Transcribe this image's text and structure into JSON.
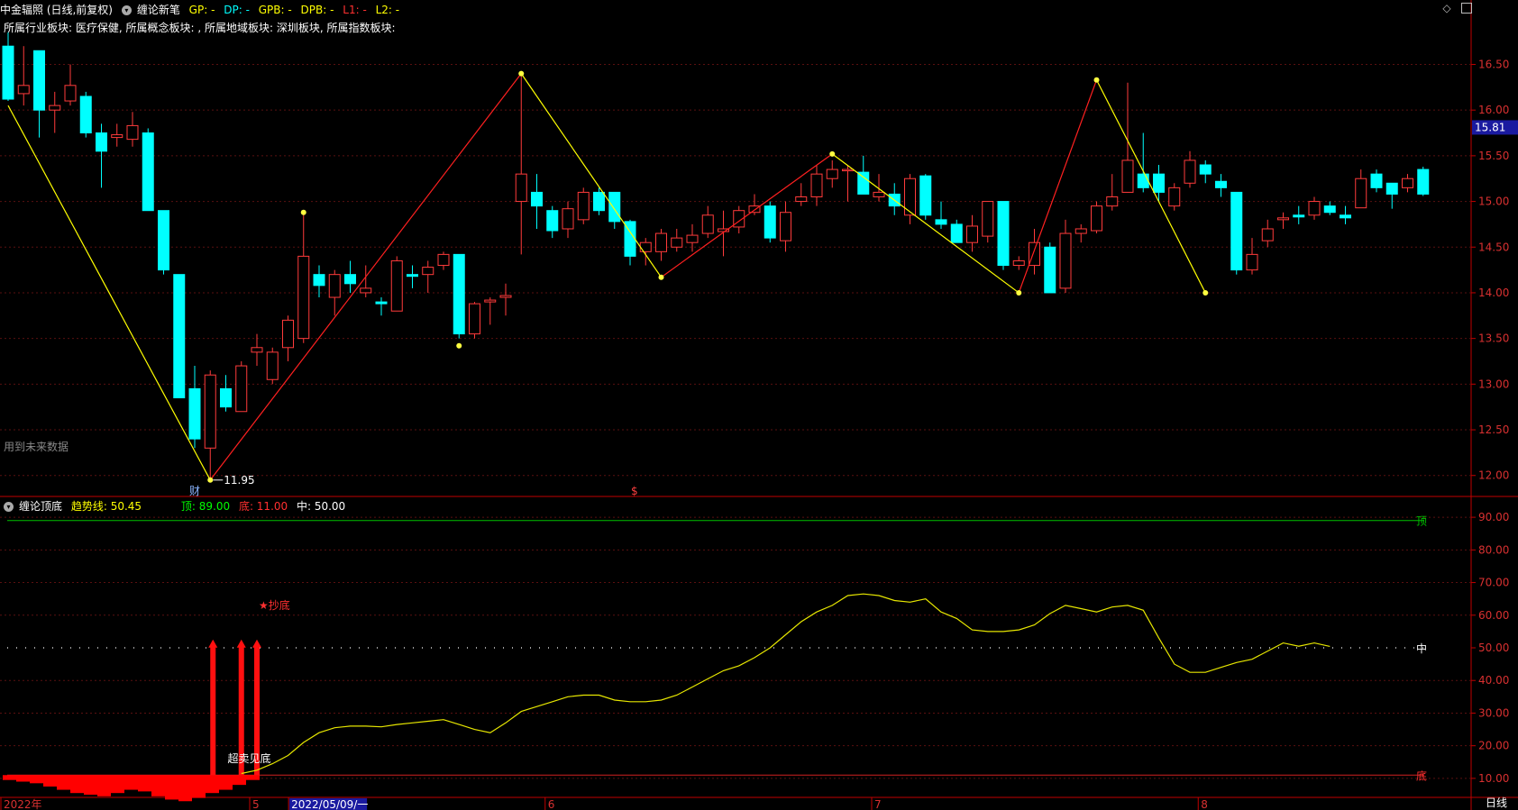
{
  "header": {
    "stock_title": "中金辐照 (日线,前复权)",
    "indicator_name": "缠论新笔",
    "gp_label": "GP: -",
    "dp_label": "DP: -",
    "gpb_label": "GPB: -",
    "dpb_label": "DPB: -",
    "l1_label": "L1: -",
    "l2_label": "L2: -",
    "industry_line": "所属行业板块: 医疗保健, 所属概念板块: , 所属地域板块: 深圳板块, 所属指数板块:",
    "overlay_text": "所属行业板块:",
    "future_data_note": "用到未来数据",
    "period_label": "日线"
  },
  "sub_header": {
    "indicator_name": "缠论顶底",
    "trend_label": "趋势线: 50.45",
    "top_label": "顶: 89.00",
    "bottom_label": "底: 11.00",
    "mid_label": "中: 50.00"
  },
  "colors": {
    "up": "#ff3b3b",
    "down": "#00ffff",
    "stroke_yellow": "#ffff00",
    "stroke_red": "#ff2020",
    "grid": "#5a1010",
    "axis": "#c00000",
    "green_line": "#00c000",
    "trend_line": "#e6e600",
    "bottom_line": "#d02020",
    "price_badge_bg": "#1a1aa0"
  },
  "chart_data": [
    {
      "type": "candlestick",
      "title": "",
      "ylim": [
        11.8,
        16.85
      ],
      "y_ticks": [
        "16.50",
        "16.00",
        "15.50",
        "15.00",
        "14.50",
        "14.00",
        "13.50",
        "13.00",
        "12.50",
        "12.00"
      ],
      "y_tick_values": [
        16.5,
        16.0,
        15.5,
        15.0,
        14.5,
        14.0,
        13.5,
        13.0,
        12.5,
        12.0
      ],
      "current_price": "15.81",
      "current_price_value": 15.81,
      "low_annotation": "11.95",
      "event_markers": [
        "财",
        "$"
      ],
      "candles": [
        [
          16.7,
          16.12,
          16.85,
          16.1
        ],
        [
          16.18,
          16.27,
          16.7,
          16.05
        ],
        [
          16.65,
          16.0,
          16.65,
          15.7
        ],
        [
          16.0,
          16.05,
          16.2,
          15.75
        ],
        [
          16.1,
          16.27,
          16.5,
          16.05
        ],
        [
          16.15,
          15.75,
          16.2,
          15.7
        ],
        [
          15.75,
          15.55,
          15.85,
          15.15
        ],
        [
          15.7,
          15.73,
          15.85,
          15.6
        ],
        [
          15.68,
          15.83,
          15.98,
          15.6
        ],
        [
          15.75,
          14.9,
          15.8,
          14.9
        ],
        [
          14.9,
          14.25,
          14.9,
          14.2
        ],
        [
          14.2,
          12.85,
          14.2,
          12.85
        ],
        [
          12.95,
          12.4,
          13.2,
          12.3
        ],
        [
          12.3,
          13.1,
          13.15,
          11.95
        ],
        [
          12.95,
          12.75,
          13.1,
          12.7
        ],
        [
          12.7,
          13.2,
          13.25,
          12.7
        ],
        [
          13.35,
          13.4,
          13.55,
          13.2
        ],
        [
          13.05,
          13.35,
          13.4,
          13.0
        ],
        [
          13.4,
          13.7,
          13.75,
          13.25
        ],
        [
          13.5,
          14.4,
          14.88,
          13.45
        ],
        [
          14.2,
          14.08,
          14.3,
          13.95
        ],
        [
          13.95,
          14.2,
          14.25,
          13.75
        ],
        [
          14.2,
          14.1,
          14.35,
          14.0
        ],
        [
          14.0,
          14.05,
          14.3,
          13.95
        ],
        [
          13.9,
          13.88,
          13.95,
          13.75
        ],
        [
          13.8,
          14.35,
          14.4,
          13.8
        ],
        [
          14.2,
          14.18,
          14.3,
          14.05
        ],
        [
          14.2,
          14.28,
          14.35,
          14.0
        ],
        [
          14.3,
          14.42,
          14.45,
          14.25
        ],
        [
          14.42,
          13.55,
          14.42,
          13.5
        ],
        [
          13.55,
          13.88,
          13.9,
          13.5
        ],
        [
          13.9,
          13.92,
          13.95,
          13.65
        ],
        [
          13.95,
          13.97,
          14.1,
          13.75
        ],
        [
          15.0,
          15.3,
          16.4,
          14.42
        ],
        [
          15.1,
          14.95,
          15.3,
          14.7
        ],
        [
          14.9,
          14.68,
          14.95,
          14.6
        ],
        [
          14.7,
          14.92,
          15.0,
          14.6
        ],
        [
          14.8,
          15.1,
          15.15,
          14.75
        ],
        [
          15.1,
          14.9,
          15.15,
          14.85
        ],
        [
          15.1,
          14.78,
          15.1,
          14.7
        ],
        [
          14.78,
          14.4,
          14.8,
          14.3
        ],
        [
          14.45,
          14.55,
          14.6,
          14.3
        ],
        [
          14.45,
          14.65,
          14.7,
          14.35
        ],
        [
          14.5,
          14.6,
          14.7,
          14.45
        ],
        [
          14.55,
          14.63,
          14.75,
          14.45
        ],
        [
          14.65,
          14.85,
          14.95,
          14.6
        ],
        [
          14.67,
          14.7,
          14.9,
          14.4
        ],
        [
          14.72,
          14.9,
          14.95,
          14.65
        ],
        [
          14.88,
          14.95,
          15.08,
          14.85
        ],
        [
          14.95,
          14.6,
          15.0,
          14.55
        ],
        [
          14.57,
          14.88,
          15.0,
          14.45
        ],
        [
          15.0,
          15.05,
          15.2,
          14.95
        ],
        [
          15.05,
          15.3,
          15.4,
          14.95
        ],
        [
          15.25,
          15.35,
          15.45,
          15.15
        ],
        [
          15.35,
          15.35,
          15.4,
          15.0
        ],
        [
          15.32,
          15.08,
          15.5,
          15.08
        ],
        [
          15.05,
          15.1,
          15.3,
          15.0
        ],
        [
          15.08,
          14.95,
          15.2,
          14.85
        ],
        [
          14.85,
          15.25,
          15.3,
          14.75
        ],
        [
          15.28,
          14.85,
          15.3,
          14.8
        ],
        [
          14.8,
          14.75,
          15.0,
          14.7
        ],
        [
          14.75,
          14.55,
          14.8,
          14.55
        ],
        [
          14.55,
          14.73,
          14.85,
          14.45
        ],
        [
          14.62,
          15.0,
          15.0,
          14.55
        ],
        [
          15.0,
          14.3,
          15.0,
          14.25
        ],
        [
          14.3,
          14.35,
          14.4,
          14.25
        ],
        [
          14.3,
          14.55,
          14.7,
          14.2
        ],
        [
          14.5,
          14.0,
          14.55,
          14.0
        ],
        [
          14.05,
          14.65,
          14.8,
          14.0
        ],
        [
          14.65,
          14.7,
          14.75,
          14.55
        ],
        [
          14.68,
          14.95,
          15.0,
          14.65
        ],
        [
          14.95,
          15.05,
          15.3,
          14.9
        ],
        [
          15.1,
          15.45,
          16.3,
          15.1
        ],
        [
          15.3,
          15.15,
          15.75,
          15.1
        ],
        [
          15.3,
          15.1,
          15.4,
          15.0
        ],
        [
          14.95,
          15.15,
          15.2,
          14.9
        ],
        [
          15.2,
          15.45,
          15.55,
          15.15
        ],
        [
          15.4,
          15.3,
          15.45,
          15.2
        ],
        [
          15.22,
          15.15,
          15.3,
          15.05
        ],
        [
          15.1,
          14.25,
          15.1,
          14.2
        ],
        [
          14.25,
          14.42,
          14.6,
          14.2
        ],
        [
          14.57,
          14.7,
          14.8,
          14.5
        ],
        [
          14.8,
          14.82,
          14.88,
          14.7
        ],
        [
          14.85,
          14.83,
          14.95,
          14.75
        ],
        [
          14.85,
          15.0,
          15.05,
          14.8
        ],
        [
          14.95,
          14.88,
          15.0,
          14.85
        ],
        [
          14.85,
          14.82,
          14.95,
          14.75
        ],
        [
          14.93,
          15.25,
          15.35,
          14.93
        ],
        [
          15.3,
          15.15,
          15.35,
          15.1
        ],
        [
          15.2,
          15.08,
          15.2,
          14.92
        ],
        [
          15.15,
          15.25,
          15.3,
          15.1
        ],
        [
          15.35,
          15.08,
          15.38,
          15.06
        ]
      ],
      "strokes": [
        {
          "points": [
            [
              0,
              16.05
            ],
            [
              13,
              11.95
            ]
          ],
          "color": "yellow"
        },
        {
          "points": [
            [
              13,
              11.95
            ],
            [
              33,
              16.4
            ]
          ],
          "color": "red"
        },
        {
          "points": [
            [
              33,
              16.4
            ],
            [
              42,
              14.17
            ]
          ],
          "color": "yellow"
        },
        {
          "points": [
            [
              42,
              14.17
            ],
            [
              53,
              15.52
            ]
          ],
          "color": "red"
        },
        {
          "points": [
            [
              53,
              15.52
            ],
            [
              65,
              14.0
            ]
          ],
          "color": "yellow"
        },
        {
          "points": [
            [
              65,
              14.0
            ],
            [
              70,
              16.33
            ]
          ],
          "color": "red"
        },
        {
          "points": [
            [
              70,
              16.33
            ],
            [
              77,
              14.0
            ]
          ],
          "color": "yellow"
        }
      ],
      "fractal_markers": [
        [
          13,
          11.95
        ],
        [
          19,
          14.88
        ],
        [
          29,
          13.42
        ],
        [
          33,
          16.4
        ],
        [
          42,
          14.17
        ],
        [
          53,
          15.52
        ],
        [
          65,
          14.0
        ],
        [
          70,
          16.33
        ],
        [
          77,
          14.0
        ]
      ]
    },
    {
      "type": "line",
      "title": "缠论顶底",
      "ylim": [
        5,
        95
      ],
      "y_ticks": [
        "90.00",
        "80.00",
        "70.00",
        "60.00",
        "50.00",
        "40.00",
        "30.00",
        "20.00",
        "10.00"
      ],
      "y_tick_values": [
        90,
        80,
        70,
        60,
        50,
        40,
        30,
        20,
        10
      ],
      "top_level": 89,
      "bottom_level": 11,
      "mid_level": 50,
      "top_tag": "顶",
      "mid_tag": "中",
      "bottom_tag": "底",
      "buy_signal_label": "★抄底",
      "oversold_label": "超卖见底",
      "trend_line": [
        [
          15,
          11.5
        ],
        [
          16,
          12.5
        ],
        [
          17,
          14.5
        ],
        [
          18,
          17.0
        ],
        [
          19,
          21.0
        ],
        [
          20,
          24.0
        ],
        [
          21,
          25.5
        ],
        [
          22,
          26.0
        ],
        [
          23,
          26.0
        ],
        [
          24,
          25.8
        ],
        [
          25,
          26.5
        ],
        [
          26,
          27.0
        ],
        [
          27,
          27.5
        ],
        [
          28,
          28.0
        ],
        [
          29,
          26.5
        ],
        [
          30,
          25.0
        ],
        [
          31,
          24.0
        ],
        [
          32,
          27.0
        ],
        [
          33,
          30.5
        ],
        [
          34,
          32.0
        ],
        [
          35,
          33.5
        ],
        [
          36,
          35.0
        ],
        [
          37,
          35.5
        ],
        [
          38,
          35.5
        ],
        [
          39,
          34.0
        ],
        [
          40,
          33.5
        ],
        [
          41,
          33.5
        ],
        [
          42,
          34.0
        ],
        [
          43,
          35.5
        ],
        [
          44,
          38.0
        ],
        [
          45,
          40.5
        ],
        [
          46,
          43.0
        ],
        [
          47,
          44.5
        ],
        [
          48,
          47.0
        ],
        [
          49,
          50.0
        ],
        [
          50,
          54.0
        ],
        [
          51,
          58.0
        ],
        [
          52,
          61.0
        ],
        [
          53,
          63.0
        ],
        [
          54,
          66.0
        ],
        [
          55,
          66.5
        ],
        [
          56,
          66.0
        ],
        [
          57,
          64.5
        ],
        [
          58,
          64.0
        ],
        [
          59,
          65.0
        ],
        [
          60,
          61.0
        ],
        [
          61,
          59.0
        ],
        [
          62,
          55.5
        ],
        [
          63,
          55.0
        ],
        [
          64,
          55.0
        ],
        [
          65,
          55.5
        ],
        [
          66,
          57.0
        ],
        [
          67,
          60.5
        ],
        [
          68,
          63.0
        ],
        [
          69,
          62.0
        ],
        [
          70,
          61.0
        ],
        [
          71,
          62.5
        ],
        [
          72,
          63.0
        ],
        [
          73,
          61.5
        ],
        [
          74,
          53.0
        ],
        [
          75,
          45.0
        ],
        [
          76,
          42.5
        ],
        [
          77,
          42.5
        ],
        [
          78,
          44.0
        ],
        [
          79,
          45.5
        ],
        [
          80,
          46.5
        ],
        [
          81,
          49.0
        ],
        [
          82,
          51.5
        ],
        [
          83,
          50.5
        ],
        [
          84,
          51.5
        ],
        [
          85,
          50.45
        ]
      ],
      "bottom_bars": [
        -1.5,
        -2.0,
        -2.5,
        -3.5,
        -4.5,
        -5.5,
        -6.0,
        -6.5,
        -5.5,
        -4.5,
        -5.0,
        -6.5,
        -7.5,
        -8.0,
        -7.0,
        -5.5,
        -4.5,
        -3.0,
        -1.5
      ],
      "signal_arrows": [
        13,
        15,
        16
      ]
    }
  ],
  "x_axis": {
    "labels": [
      "2022年",
      "5",
      "2022/05/09/一",
      "6",
      "7",
      "8"
    ],
    "label_positions": [
      0,
      16,
      18.5,
      35,
      56,
      77
    ]
  }
}
